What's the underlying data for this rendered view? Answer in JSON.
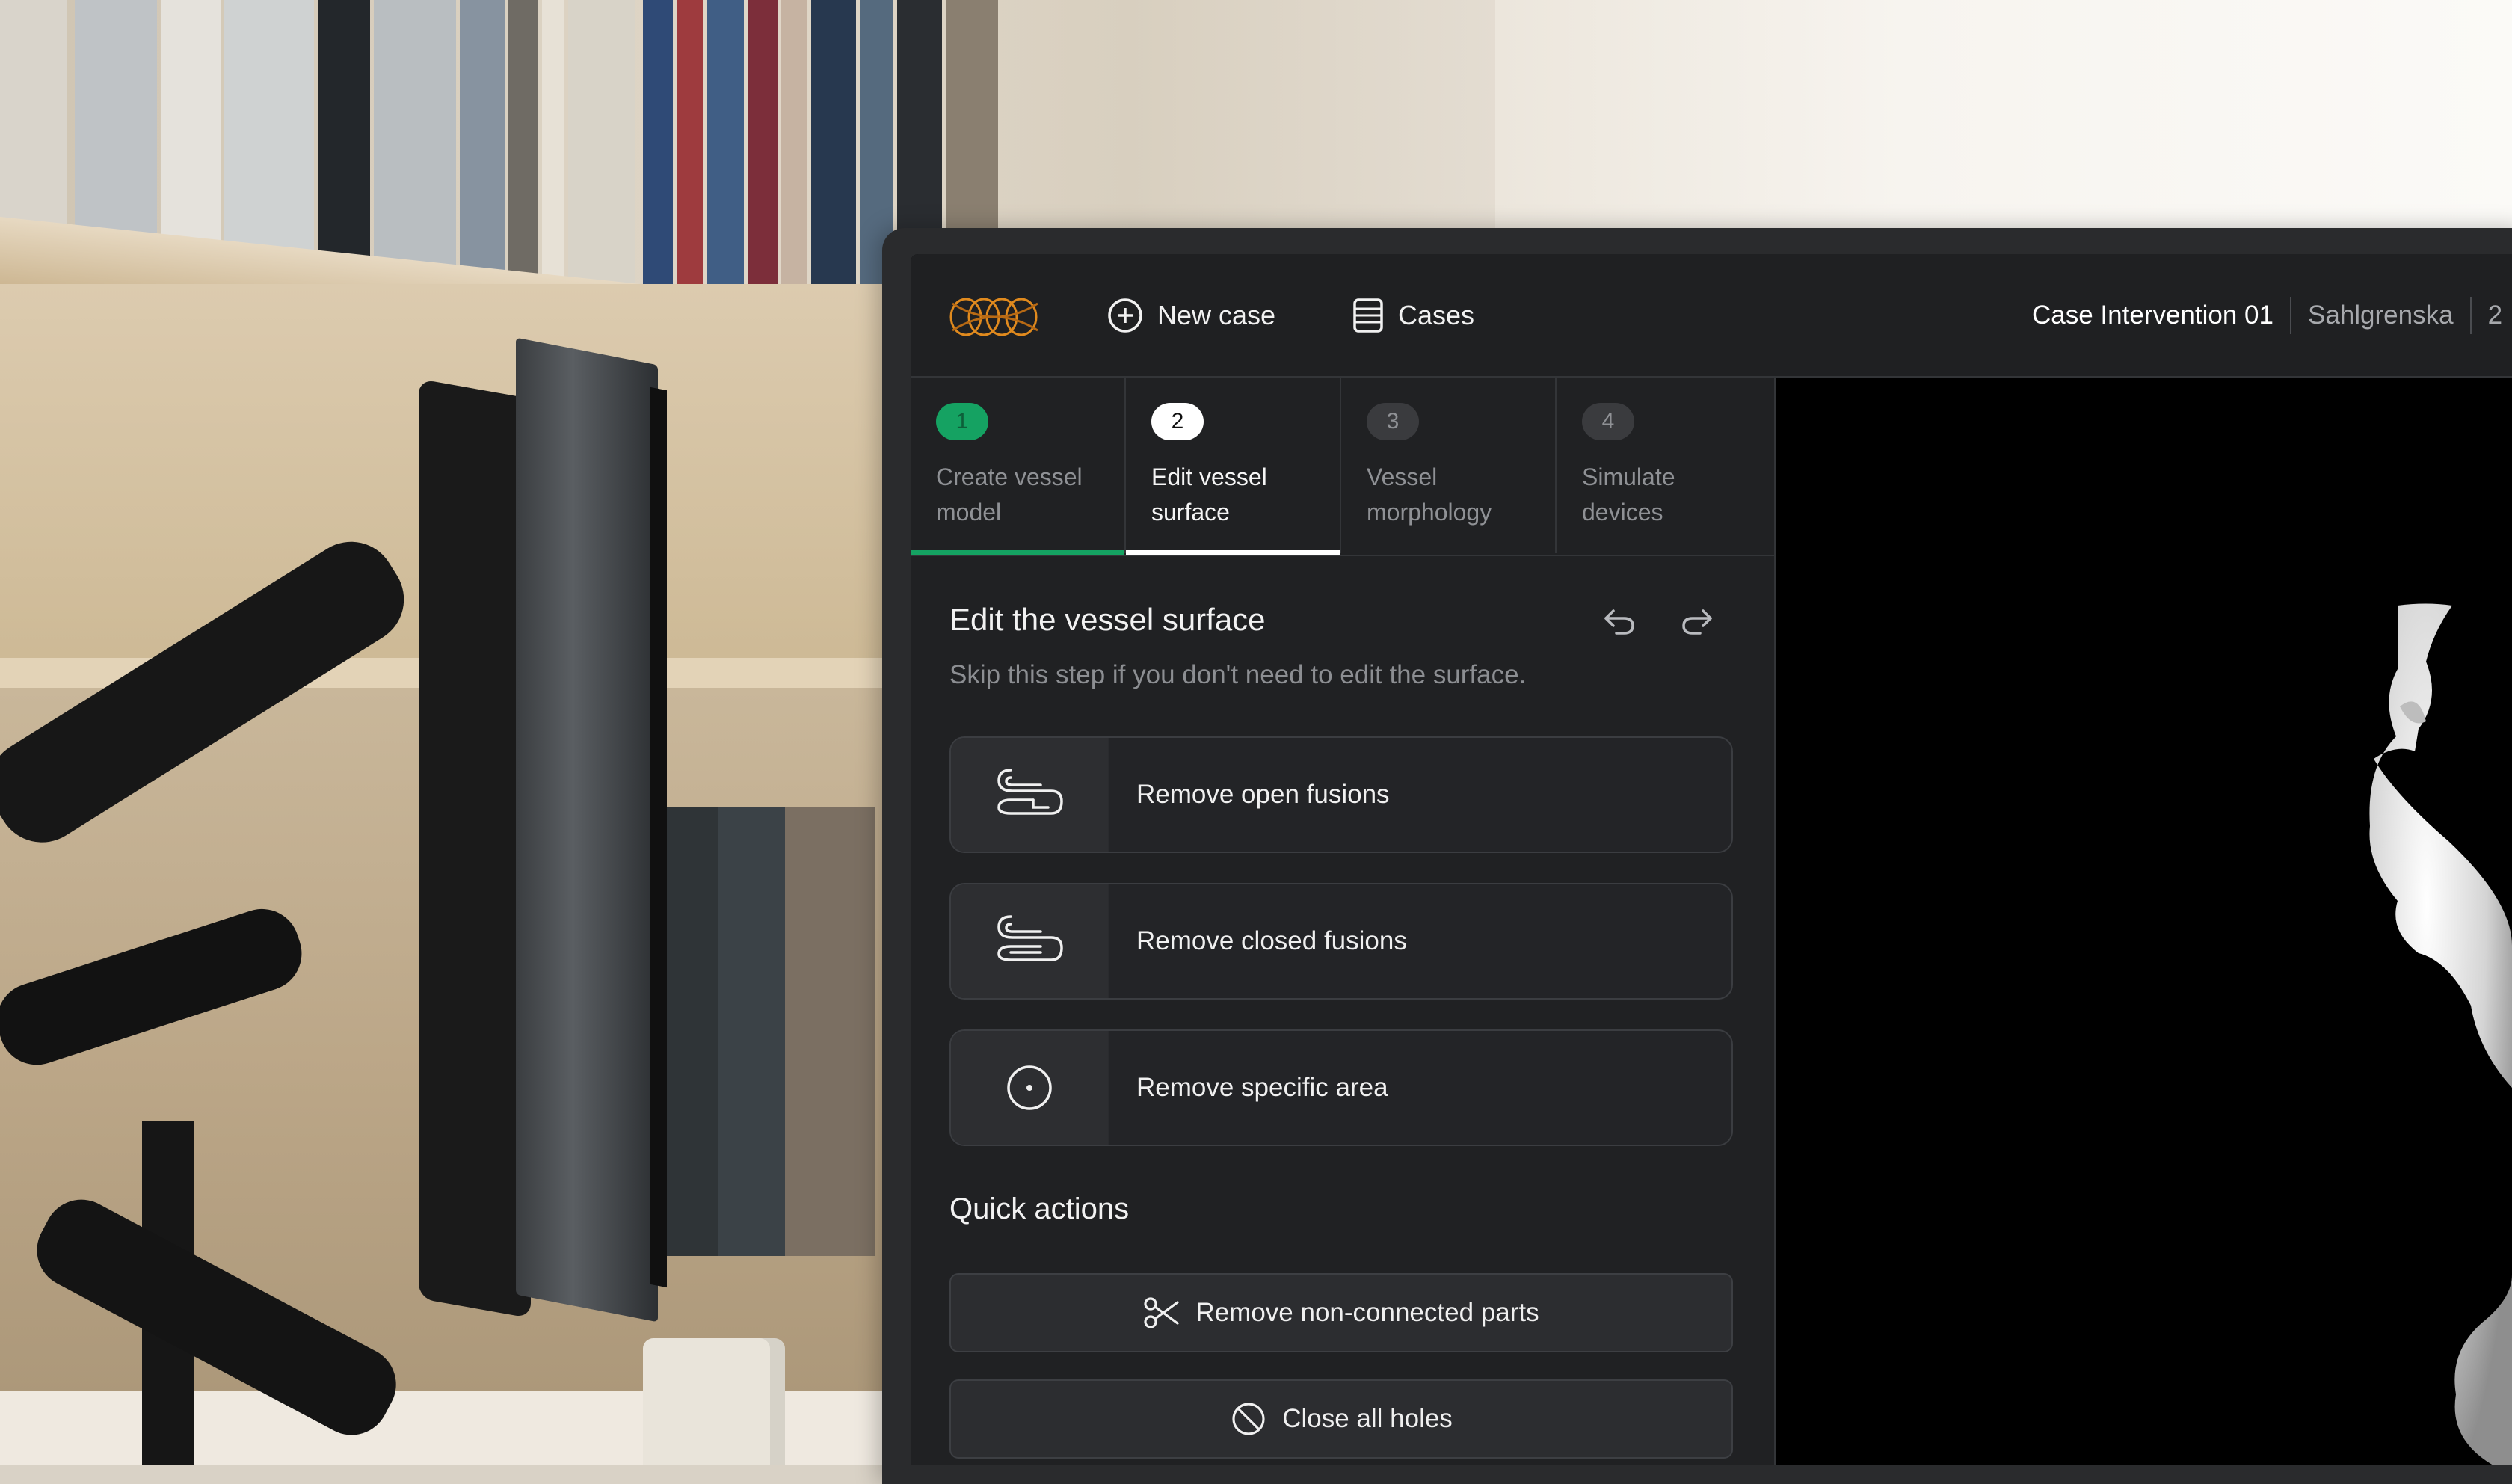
{
  "header": {
    "new_case_label": "New case",
    "cases_label": "Cases",
    "case_title": "Case Intervention 01",
    "case_location": "Sahlgrenska",
    "case_extra": "2"
  },
  "steps": [
    {
      "number": "1",
      "label": "Create vessel model",
      "state": "done"
    },
    {
      "number": "2",
      "label": "Edit vessel surface",
      "state": "active"
    },
    {
      "number": "3",
      "label": "Vessel morphology",
      "state": "todo"
    },
    {
      "number": "4",
      "label": "Simulate devices",
      "state": "todo"
    }
  ],
  "edit": {
    "title": "Edit the vessel surface",
    "subtitle": "Skip this step if you don't need to edit the surface.",
    "tools": [
      {
        "label": "Remove open fusions",
        "icon": "open-fusion-icon"
      },
      {
        "label": "Remove closed fusions",
        "icon": "closed-fusion-icon"
      },
      {
        "label": "Remove specific area",
        "icon": "target-icon"
      }
    ]
  },
  "quick": {
    "title": "Quick actions",
    "actions": [
      {
        "label": "Remove non-connected parts",
        "icon": "scissors-icon"
      },
      {
        "label": "Close all holes",
        "icon": "prohibit-icon"
      }
    ]
  },
  "colors": {
    "accent_green": "#15a262",
    "panel": "#202123",
    "logo_orange": "#e08a1e"
  }
}
